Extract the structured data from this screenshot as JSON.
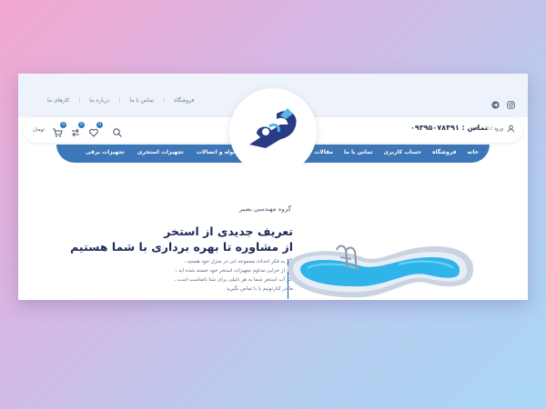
{
  "top_links": [
    "فروشگاه",
    "تماس با ما",
    "درباره ما",
    "کارهای ما"
  ],
  "social_icons": [
    "instagram-icon",
    "telegram-icon"
  ],
  "header": {
    "phone_label": "تماس :",
    "phone_number": "۰۹۳۹۵۰۷۸۴۹۱",
    "login_text": "ورود / ثبت نام",
    "cart_label": "تومان",
    "cart_count": "0",
    "compare_count": "0",
    "wishlist_count": "0"
  },
  "nav": {
    "right_items": [
      "خانه",
      "فروشگاه",
      "حساب کاربری",
      "تماس با ما",
      "مقالات"
    ],
    "left_items": [
      "لوله و اتصالات",
      "تجهیزات استخری",
      "تجهیزات برقی"
    ]
  },
  "hero": {
    "company": "گروه مهندسی بصیر",
    "headline_line1": "تعریف جدیدی از استخر",
    "headline_line2": "از مشاوره تا بهره برداری با شما هستیم",
    "body_lines": [
      "اگر به فکر احداث مجموعه ابی در منزل خود هستید ،",
      "اگر از خرابی مداوم تجهیزات استخر خود خسته شده اید ،",
      "اگر آب استخر شما به هر دلیلی برای شنا نامناسب است ،",
      "ما در کنارتونیم یا با تماس بگیرید ."
    ]
  },
  "colors": {
    "accent": "#3e77b7",
    "headline": "#1f2a58",
    "pool_water": "#2fb4ea"
  }
}
